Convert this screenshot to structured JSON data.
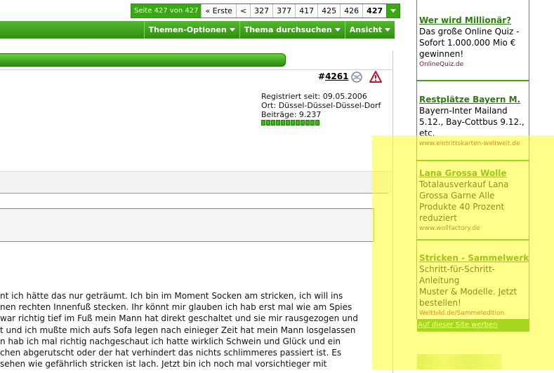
{
  "pagination": {
    "status": "Seite 427 von 427",
    "items": [
      "« Erste",
      "<",
      "327",
      "377",
      "417",
      "425",
      "426",
      "427"
    ],
    "current": "427"
  },
  "toolbar": {
    "items": [
      "Themen-Optionen",
      "Thema durchsuchen",
      "Ansicht"
    ]
  },
  "post": {
    "hash": "#",
    "number": "4261",
    "registered": "Registriert seit: 09.05.2006",
    "location": "Ort: Düssel-Düssel-Düssel-Dorf",
    "posts": "Beiträge: 9.237",
    "reputation_pips": 12,
    "text_lines": [
      "nt ich hätte das nur geträumt. Ich bin im Moment Socken am stricken, ich will ins",
      "nen rechten Innenfuß stecken. Ihr könnt mir glauben ich hab erst mal wie am Spies",
      "war richtig tief im Fuß mein Mann hat direkt geschaltet und sie mir rausgezogen und",
      "t und ich mußte mich aufs Sofa legen nach einieger Zeit hat mein Mann losgelassen",
      "n hab ich mal richtig nachgeschaut ich hatte wirklich Schwein und Glück und ein",
      "chen abgerutscht oder der hat verhindert das nichts schlimmeres passiert ist. Es",
      "sehen wie gefährlich stricken ist lach. Jetzt bin ich noch mal vorsichtieger mit"
    ]
  },
  "ads": {
    "items": [
      {
        "title": "Wer wird Millionär?",
        "body": [
          "Das große Online Quiz -",
          "Sofort 1.000.000 Mio €",
          "gewinnen!"
        ],
        "url": "OnlineQuiz.de"
      },
      {
        "title": "Restplätze Bayern M.",
        "body": [
          "Bayern-Inter Mailand",
          "5.12., Bay-Cottbus 9.12.,",
          "etc."
        ],
        "url": "www.eintrittskarten-weltweit.de"
      },
      {
        "title": "Lana Grossa Wolle",
        "body": [
          "Totalausverkauf Lana",
          "Grossa Garne Alle",
          "Produkte 40 Prozent",
          "reduziert"
        ],
        "url": "www.wollfactory.de"
      },
      {
        "title": "Stricken - Sammelwerk",
        "body": [
          "Schritt-für-Schritt-Anleitung",
          "Muster & Modelle. Jetzt",
          "bestellen!"
        ],
        "url": "Weltbild.de/Sammeledition"
      }
    ],
    "footer": "Auf dieser Site werben"
  },
  "colors": {
    "accent_green": "#3aa815",
    "highlight": "#ffff28"
  }
}
